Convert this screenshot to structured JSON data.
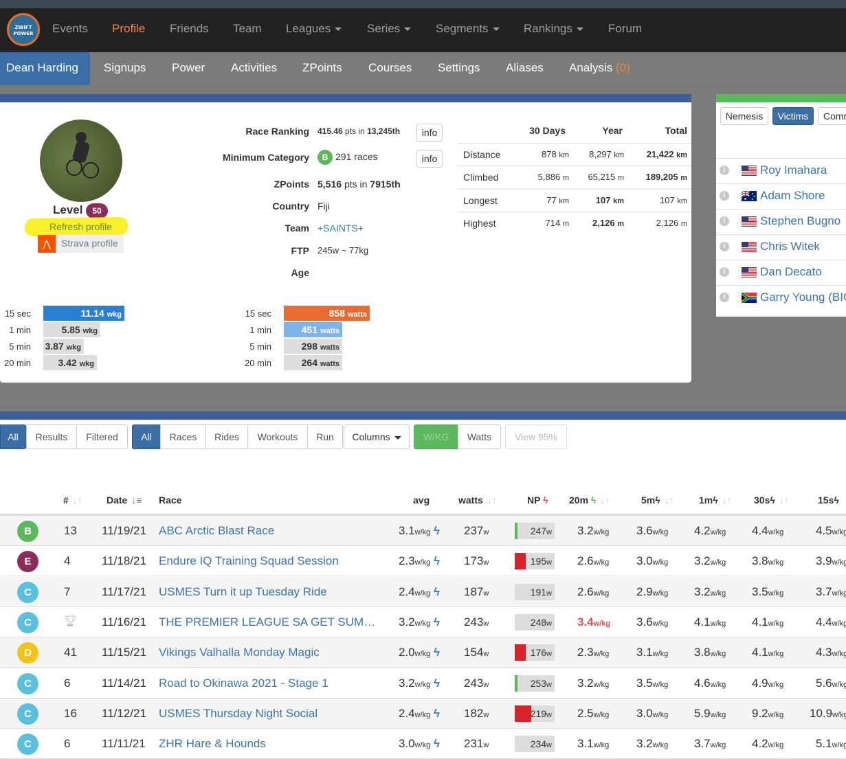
{
  "nav": {
    "logo": "ZWIFT POWER",
    "items": [
      {
        "label": "Events",
        "dropdown": false
      },
      {
        "label": "Profile",
        "dropdown": false,
        "active": true
      },
      {
        "label": "Friends",
        "dropdown": false
      },
      {
        "label": "Team",
        "dropdown": false
      },
      {
        "label": "Leagues",
        "dropdown": true
      },
      {
        "label": "Series",
        "dropdown": true
      },
      {
        "label": "Segments",
        "dropdown": true
      },
      {
        "label": "Rankings",
        "dropdown": true
      },
      {
        "label": "Forum",
        "dropdown": false
      }
    ]
  },
  "subnav": {
    "items": [
      "Dean Harding",
      "Signups",
      "Power",
      "Activities",
      "ZPoints",
      "Courses",
      "Settings",
      "Aliases",
      "Analysis"
    ],
    "analysis_count": "(0)"
  },
  "profile": {
    "level_label": "Level",
    "level": "50",
    "refresh": "Refresh profile",
    "strava": "Strava profile",
    "race_ranking_label": "Race Ranking",
    "race_ranking_pts": "415.46",
    "race_ranking_mid": "pts in",
    "race_ranking_pos": "13,245th",
    "min_cat_label": "Minimum Category",
    "min_cat": "B",
    "min_cat_races": "291 races",
    "zpoints_label": "ZPoints",
    "zpoints_pts": "5,516",
    "zpoints_mid": "pts in",
    "zpoints_pos": "7915th",
    "country_label": "Country",
    "country": "Fiji",
    "team_label": "Team",
    "team": "+SAINTS+",
    "ftp_label": "FTP",
    "ftp": "245w ~ 77kg",
    "age_label": "Age",
    "info": "info"
  },
  "stats": {
    "headers": [
      "30 Days",
      "Year",
      "Total"
    ],
    "rows": [
      {
        "label": "Distance",
        "v": [
          "878",
          "8,297",
          "21,422"
        ],
        "u": "km",
        "bold": 2
      },
      {
        "label": "Climbed",
        "v": [
          "5,886",
          "65,215",
          "189,205"
        ],
        "u": "m",
        "bold": 2
      },
      {
        "label": "Longest",
        "v": [
          "77",
          "107",
          "107"
        ],
        "u": "km",
        "bold": 1
      },
      {
        "label": "Highest",
        "v": [
          "714",
          "2,126",
          "2,126"
        ],
        "u": "m",
        "bold": 1
      }
    ]
  },
  "power_wkg": [
    {
      "label": "15 sec",
      "value": "11.14",
      "unit": "wkg",
      "color": "#2a7fd4",
      "fraction": 1.0
    },
    {
      "label": "1 min",
      "value": "5.85",
      "unit": "wkg",
      "color": "#ddd",
      "fraction": 0.7
    },
    {
      "label": "5 min",
      "value": "3.87",
      "unit": "wkg",
      "color": "#ddd",
      "fraction": 0.5
    },
    {
      "label": "20 min",
      "value": "3.42",
      "unit": "wkg",
      "color": "#ddd",
      "fraction": 0.66
    }
  ],
  "power_watts": [
    {
      "label": "15 sec",
      "value": "858",
      "unit": "watts",
      "color": "#ea6b32",
      "fraction": 1.0
    },
    {
      "label": "1 min",
      "value": "451",
      "unit": "watts",
      "color": "#7cb5ec",
      "fraction": 0.68
    },
    {
      "label": "5 min",
      "value": "298",
      "unit": "watts",
      "color": "#ddd",
      "fraction": 0.68
    },
    {
      "label": "20 min",
      "value": "264",
      "unit": "watts",
      "color": "#ddd",
      "fraction": 0.68
    }
  ],
  "rivals": {
    "tabs": [
      "Nemesis",
      "Victims",
      "Comr"
    ],
    "active_tab": "Victims",
    "info_icon": "i",
    "list": [
      {
        "name": "Roy Imahara",
        "flag": "us"
      },
      {
        "name": "Adam Shore",
        "flag": "au"
      },
      {
        "name": "Stephen Bugno",
        "flag": "us"
      },
      {
        "name": "Chris Witek",
        "flag": "us"
      },
      {
        "name": "Dan Decato",
        "flag": "us"
      },
      {
        "name": "Garry Young (BIC",
        "flag": "za"
      }
    ]
  },
  "filters": {
    "group1": [
      "All",
      "Results",
      "Filtered"
    ],
    "group2": [
      "All",
      "Races",
      "Rides",
      "Workouts",
      "Run"
    ],
    "columns": "Columns",
    "wkg": "W/KG",
    "watts": "Watts",
    "view95": "View 95%"
  },
  "table": {
    "headers": {
      "num": "#",
      "date": "Date",
      "race": "Race",
      "avg": "avg",
      "watts": "watts",
      "np": "NP",
      "m20": "20m",
      "m5": "5m",
      "m1": "1m",
      "s30": "30s",
      "s15": "15s"
    },
    "wkg_unit": "w/kg",
    "w_unit": "w",
    "rows": [
      {
        "cat": "B",
        "num": "13",
        "date": "11/19/21",
        "race": "ABC Arctic Blast Race",
        "avg": "3.1",
        "watts": "237",
        "np": "247",
        "npmark": "green",
        "m20": "3.2",
        "m5": "3.6",
        "m1": "4.2",
        "s30": "4.4",
        "s15": "4.5"
      },
      {
        "cat": "E",
        "num": "4",
        "date": "11/18/21",
        "race": "Endure IQ Training Squad Session",
        "avg": "2.3",
        "watts": "173",
        "np": "195",
        "npmark": "red",
        "m20": "2.6",
        "m5": "3.0",
        "m1": "3.2",
        "s30": "3.8",
        "s15": "3.9"
      },
      {
        "cat": "C",
        "num": "7",
        "date": "11/17/21",
        "race": "USMES Turn it up Tuesday Ride",
        "avg": "2.4",
        "watts": "187",
        "np": "191",
        "npmark": "none",
        "m20": "2.6",
        "m5": "2.9",
        "m1": "3.2",
        "s30": "3.5",
        "s15": "3.7"
      },
      {
        "cat": "C",
        "num": "",
        "trophy": true,
        "date": "11/16/21",
        "race": "THE PREMIER LEAGUE SA GET SUMMER READY RIDE",
        "avg": "3.2",
        "watts": "243",
        "np": "248",
        "npmark": "none",
        "m20": "3.4",
        "m20red": true,
        "m5": "3.6",
        "m1": "4.1",
        "s30": "4.1",
        "s15": "4.4"
      },
      {
        "cat": "D",
        "num": "41",
        "date": "11/15/21",
        "race": "Vikings Valhalla Monday Magic",
        "avg": "2.0",
        "watts": "154",
        "np": "176",
        "npmark": "red",
        "m20": "2.3",
        "m5": "3.1",
        "m1": "3.8",
        "s30": "4.1",
        "s15": "4.3"
      },
      {
        "cat": "C",
        "num": "6",
        "date": "11/14/21",
        "race": "Road to Okinawa 2021 - Stage 1",
        "avg": "3.2",
        "watts": "243",
        "np": "253",
        "npmark": "green",
        "m20": "3.2",
        "m5": "3.5",
        "m1": "4.6",
        "s30": "4.9",
        "s15": "5.6"
      },
      {
        "cat": "C",
        "num": "16",
        "date": "11/12/21",
        "race": "USMES Thursday Night Social",
        "avg": "2.4",
        "watts": "182",
        "np": "219",
        "npmark": "redwide",
        "m20": "2.5",
        "m5": "3.0",
        "m1": "5.9",
        "s30": "9.2",
        "s15": "10.9"
      },
      {
        "cat": "C",
        "num": "6",
        "date": "11/11/21",
        "race": "ZHR Hare & Hounds",
        "avg": "3.0",
        "watts": "231",
        "np": "234",
        "npmark": "none",
        "m20": "3.1",
        "m5": "3.2",
        "m1": "3.7",
        "s30": "4.2",
        "s15": "5.1"
      }
    ],
    "cat_colors": {
      "B": "#5cb85c",
      "C": "#5bc0de",
      "D": "#f0c419",
      "E": "#8b2c5b"
    }
  }
}
